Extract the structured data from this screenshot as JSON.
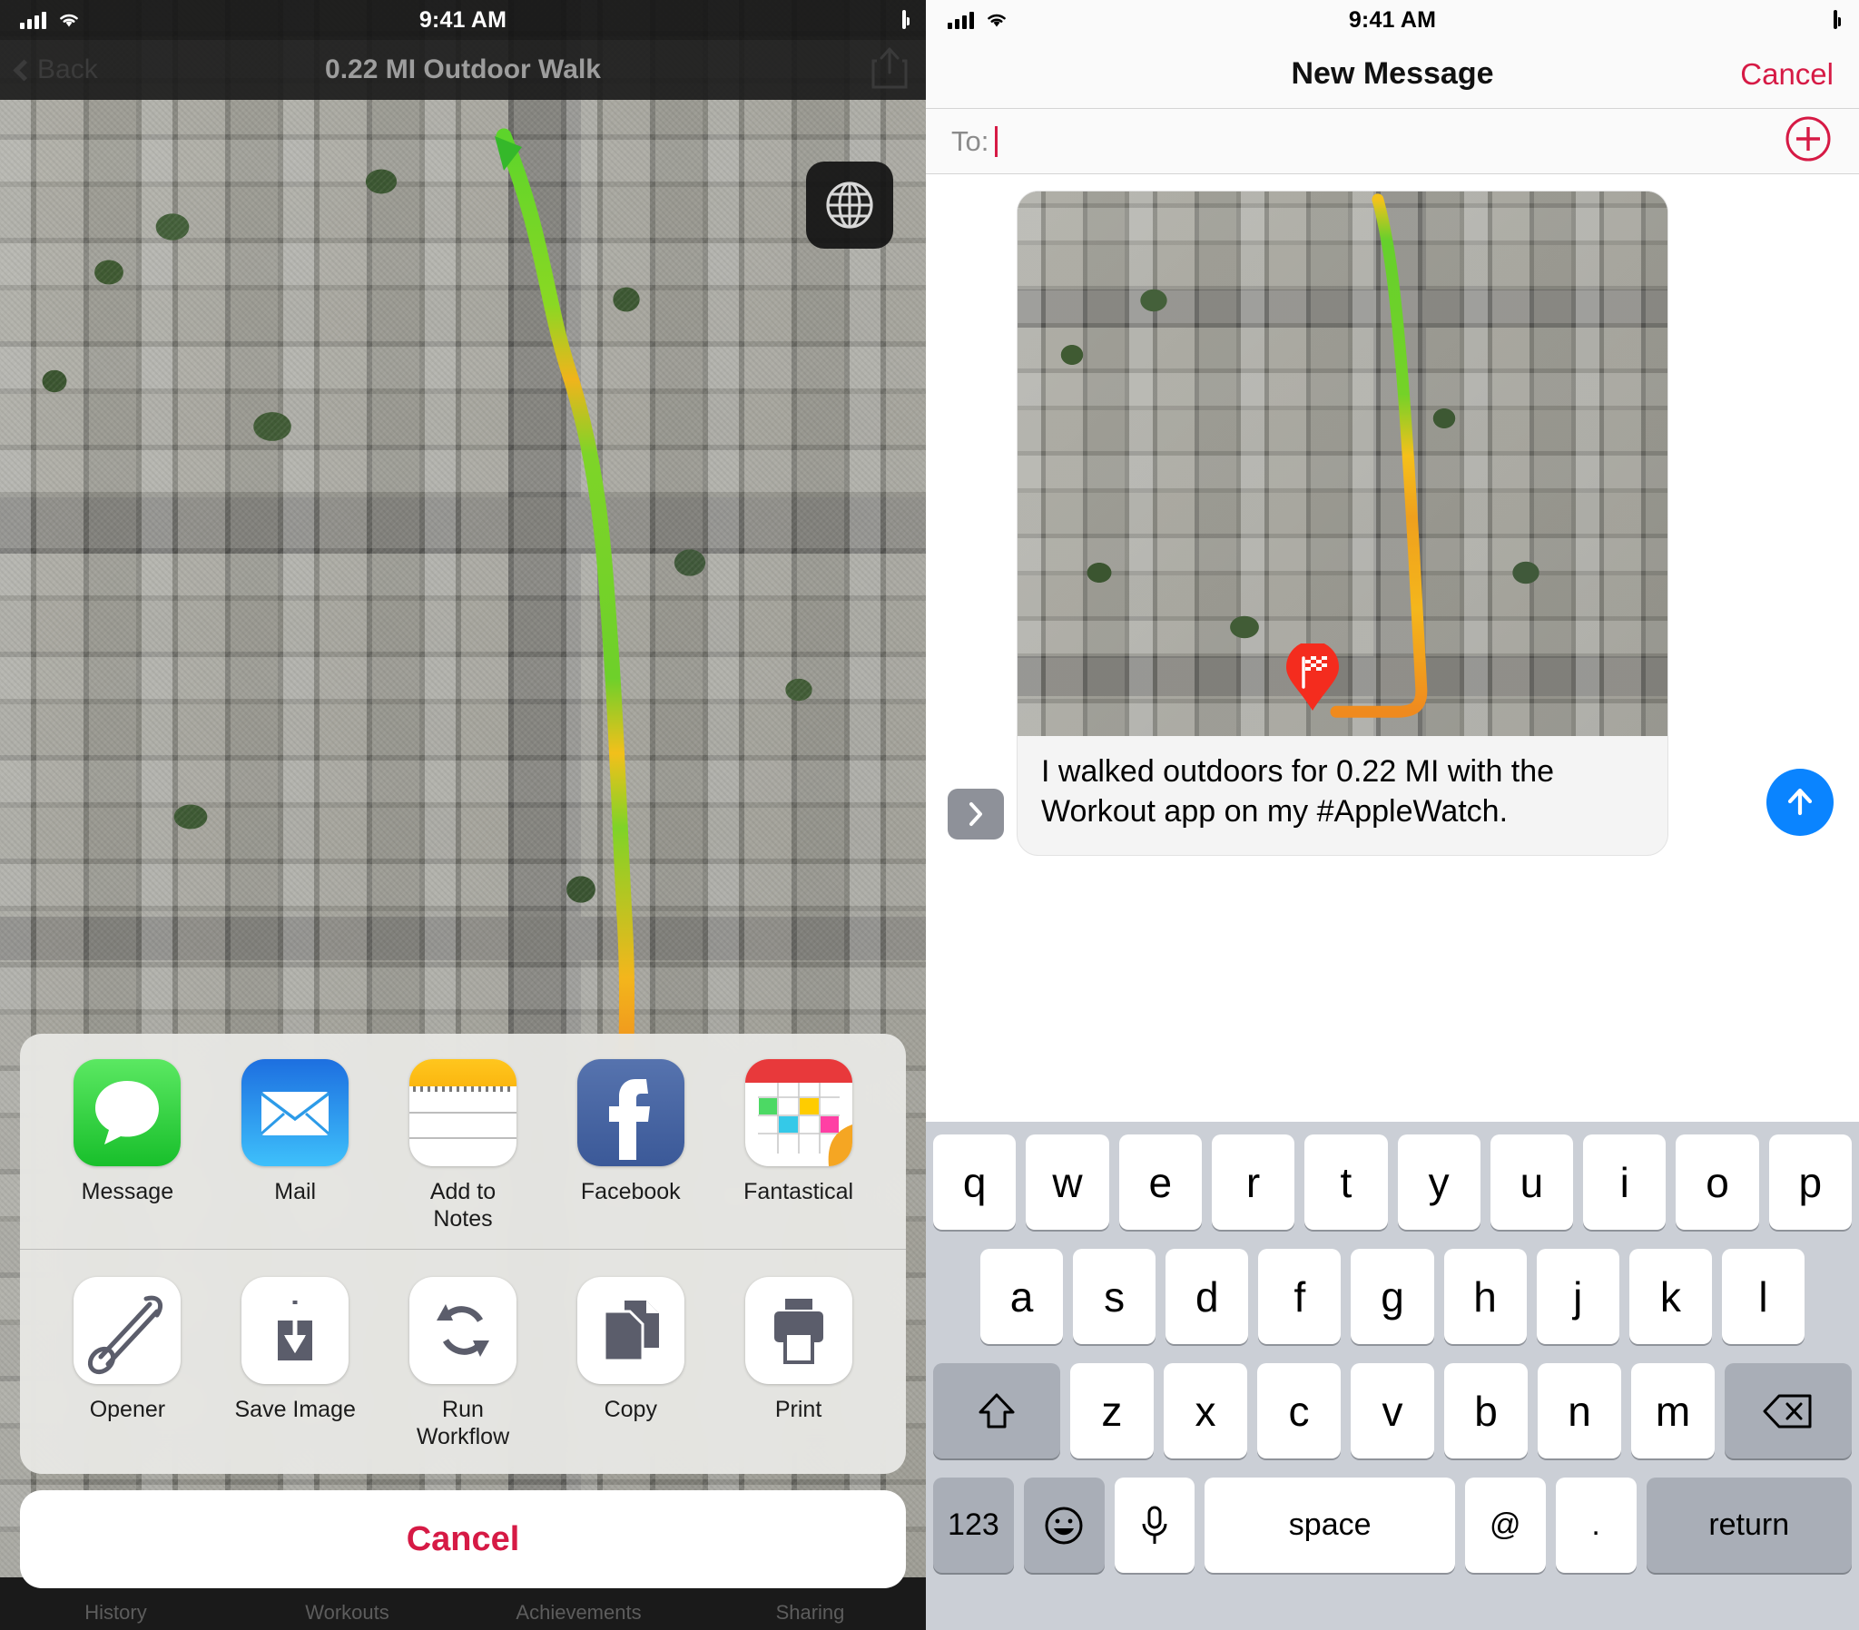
{
  "left_phone": {
    "status_bar": {
      "time": "9:41 AM",
      "signal_icon": "cellular-bars-icon",
      "wifi_icon": "wifi-icon",
      "battery_icon": "battery-icon"
    },
    "nav_bar": {
      "back_label": "Back",
      "back_icon": "chevron-left-icon",
      "title": "0.22 MI Outdoor Walk",
      "share_icon": "share-icon"
    },
    "map": {
      "map_type_toggle_icon": "globe-icon",
      "route_start_icon": "route-start-marker"
    },
    "share_sheet": {
      "apps_row": [
        {
          "label": "Message",
          "icon": "imessage-app-icon"
        },
        {
          "label": "Mail",
          "icon": "mail-app-icon"
        },
        {
          "label": "Add to Notes",
          "icon": "notes-app-icon"
        },
        {
          "label": "Facebook",
          "icon": "facebook-app-icon"
        },
        {
          "label": "Fantastical",
          "icon": "fantastical-app-icon"
        }
      ],
      "actions_row": [
        {
          "label": "Opener",
          "icon": "opener-safety-pin-icon"
        },
        {
          "label": "Save Image",
          "icon": "save-image-icon"
        },
        {
          "label": "Run Workflow",
          "icon": "run-workflow-icon"
        },
        {
          "label": "Copy",
          "icon": "copy-icon"
        },
        {
          "label": "Print",
          "icon": "print-icon"
        }
      ],
      "cancel_label": "Cancel"
    },
    "tab_bar": [
      {
        "label": "History"
      },
      {
        "label": "Workouts"
      },
      {
        "label": "Achievements"
      },
      {
        "label": "Sharing"
      }
    ]
  },
  "right_phone": {
    "status_bar": {
      "time": "9:41 AM",
      "signal_icon": "cellular-bars-icon",
      "wifi_icon": "wifi-icon",
      "battery_icon": "battery-icon"
    },
    "nav_bar": {
      "title": "New Message",
      "cancel_label": "Cancel"
    },
    "to_field": {
      "label": "To:",
      "value": "",
      "placeholder": "",
      "add_contact_icon": "plus-circle-icon"
    },
    "message": {
      "expand_icon": "chevron-right-icon",
      "attachment_icon": "workout-route-map-image",
      "finish_pin_icon": "checkered-flag-pin-icon",
      "body": "I walked outdoors for 0.22 MI with the Workout app on my #AppleWatch.",
      "send_icon": "send-arrow-up-icon"
    },
    "keyboard": {
      "row1": [
        "q",
        "w",
        "e",
        "r",
        "t",
        "y",
        "u",
        "i",
        "o",
        "p"
      ],
      "row2": [
        "a",
        "s",
        "d",
        "f",
        "g",
        "h",
        "j",
        "k",
        "l"
      ],
      "row3_letters": [
        "z",
        "x",
        "c",
        "v",
        "b",
        "n",
        "m"
      ],
      "shift_icon": "shift-arrow-up-icon",
      "backspace_icon": "backspace-delete-icon",
      "numbers_label": "123",
      "emoji_icon": "emoji-smiley-icon",
      "dictation_icon": "microphone-icon",
      "space_label": "space",
      "at_label": "@",
      "period_label": ".",
      "return_label": "return"
    }
  },
  "colors": {
    "accent_red": "#D61A45",
    "send_blue": "#0A84FF",
    "route_green": "#5DD42B",
    "route_yellow": "#F5C518",
    "route_orange": "#F08A1E",
    "keyboard_bg": "#CBCFD6"
  }
}
